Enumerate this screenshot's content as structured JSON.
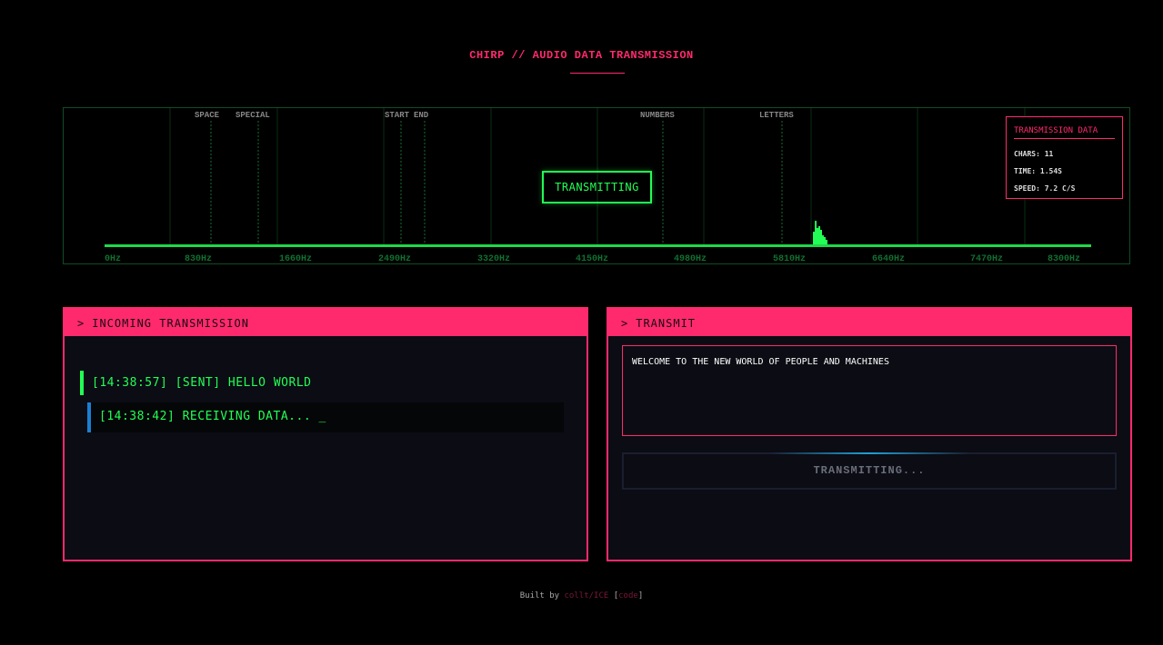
{
  "header": {
    "title": "CHIRP // AUDIO DATA TRANSMISSION"
  },
  "spectrum": {
    "band_labels": [
      "SPACE",
      "SPECIAL",
      "START",
      "END",
      "NUMBERS",
      "LETTERS"
    ],
    "freq_labels": [
      "0Hz",
      "830Hz",
      "1660Hz",
      "2490Hz",
      "3320Hz",
      "4150Hz",
      "4980Hz",
      "5810Hz",
      "6640Hz",
      "7470Hz",
      "8300Hz"
    ],
    "status": "TRANSMITTING",
    "colors": {
      "accent": "#22ff55",
      "dim": "#0f4d22",
      "label": "#888888"
    }
  },
  "transmission_data": {
    "heading": "TRANSMISSION DATA",
    "chars": "CHARS: 11",
    "time": "TIME: 1.54S",
    "speed": "SPEED: 7.2 C/S"
  },
  "incoming": {
    "chevron": ">",
    "title": "INCOMING TRANSMISSION",
    "sent": "[14:38:57] [SENT] HELLO WORLD",
    "receiving": "[14:38:42] RECEIVING DATA...",
    "cursor": "_"
  },
  "transmit": {
    "chevron": ">",
    "title": "TRANSMIT",
    "message": "WELCOME TO THE NEW WORLD OF PEOPLE AND MACHINES",
    "button_label": "TRANSMITTING..."
  },
  "footer": {
    "prefix": "Built by",
    "author": "collt/ICE",
    "open_bracket": "[",
    "code_link": "code",
    "close_bracket": "]"
  },
  "theme": {
    "primary": "#ff2a6d",
    "panel_bg": "#0b0c14",
    "sent_bar": "#22ff55",
    "recv_bar": "#1a7fd4"
  }
}
